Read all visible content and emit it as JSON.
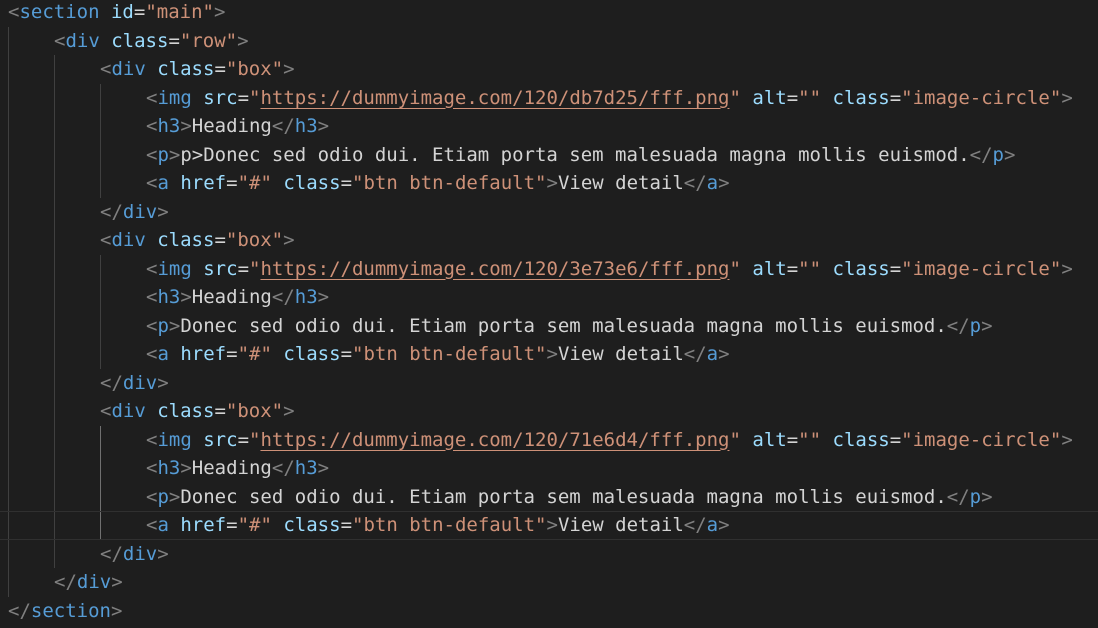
{
  "colors": {
    "background": "#1e1e1e",
    "punctuation": "#808080",
    "tag": "#569cd6",
    "attribute": "#9cdcfe",
    "string": "#ce9178",
    "text": "#d4d4d4"
  },
  "lines": [
    [
      [
        "pun",
        "<"
      ],
      [
        "tag",
        "section"
      ],
      [
        "plain",
        " "
      ],
      [
        "attr",
        "id"
      ],
      [
        "plain",
        "="
      ],
      [
        "str",
        "\"main\""
      ],
      [
        "pun",
        ">"
      ]
    ],
    [
      [
        "pun",
        "<"
      ],
      [
        "tag",
        "div"
      ],
      [
        "plain",
        " "
      ],
      [
        "attr",
        "class"
      ],
      [
        "plain",
        "="
      ],
      [
        "str",
        "\"row\""
      ],
      [
        "pun",
        ">"
      ]
    ],
    [
      [
        "pun",
        "<"
      ],
      [
        "tag",
        "div"
      ],
      [
        "plain",
        " "
      ],
      [
        "attr",
        "class"
      ],
      [
        "plain",
        "="
      ],
      [
        "str",
        "\"box\""
      ],
      [
        "pun",
        ">"
      ]
    ],
    [
      [
        "pun",
        "<"
      ],
      [
        "tag",
        "img"
      ],
      [
        "plain",
        " "
      ],
      [
        "attr",
        "src"
      ],
      [
        "plain",
        "="
      ],
      [
        "str",
        "\""
      ],
      [
        "link",
        "https://dummyimage.com/120/db7d25/fff.png"
      ],
      [
        "str",
        "\""
      ],
      [
        "plain",
        " "
      ],
      [
        "attr",
        "alt"
      ],
      [
        "plain",
        "="
      ],
      [
        "str",
        "\"\""
      ],
      [
        "plain",
        " "
      ],
      [
        "attr",
        "class"
      ],
      [
        "plain",
        "="
      ],
      [
        "str",
        "\"image-circle\""
      ],
      [
        "pun",
        ">"
      ]
    ],
    [
      [
        "pun",
        "<"
      ],
      [
        "tag",
        "h3"
      ],
      [
        "pun",
        ">"
      ],
      [
        "plain",
        "Heading"
      ],
      [
        "pun",
        "</"
      ],
      [
        "tag",
        "h3"
      ],
      [
        "pun",
        ">"
      ]
    ],
    [
      [
        "pun",
        "<"
      ],
      [
        "tag",
        "p"
      ],
      [
        "pun",
        ">"
      ],
      [
        "plain",
        "p>Donec sed odio dui. Etiam porta sem malesuada magna mollis euismod."
      ],
      [
        "pun",
        "</"
      ],
      [
        "tag",
        "p"
      ],
      [
        "pun",
        ">"
      ]
    ],
    [
      [
        "pun",
        "<"
      ],
      [
        "tag",
        "a"
      ],
      [
        "plain",
        " "
      ],
      [
        "attr",
        "href"
      ],
      [
        "plain",
        "="
      ],
      [
        "str",
        "\"#\""
      ],
      [
        "plain",
        " "
      ],
      [
        "attr",
        "class"
      ],
      [
        "plain",
        "="
      ],
      [
        "str",
        "\"btn btn-default\""
      ],
      [
        "pun",
        ">"
      ],
      [
        "plain",
        "View detail"
      ],
      [
        "pun",
        "</"
      ],
      [
        "tag",
        "a"
      ],
      [
        "pun",
        ">"
      ]
    ],
    [
      [
        "pun",
        "</"
      ],
      [
        "tag",
        "div"
      ],
      [
        "pun",
        ">"
      ]
    ],
    [
      [
        "pun",
        "<"
      ],
      [
        "tag",
        "div"
      ],
      [
        "plain",
        " "
      ],
      [
        "attr",
        "class"
      ],
      [
        "plain",
        "="
      ],
      [
        "str",
        "\"box\""
      ],
      [
        "pun",
        ">"
      ]
    ],
    [
      [
        "pun",
        "<"
      ],
      [
        "tag",
        "img"
      ],
      [
        "plain",
        " "
      ],
      [
        "attr",
        "src"
      ],
      [
        "plain",
        "="
      ],
      [
        "str",
        "\""
      ],
      [
        "link",
        "https://dummyimage.com/120/3e73e6/fff.png"
      ],
      [
        "str",
        "\""
      ],
      [
        "plain",
        " "
      ],
      [
        "attr",
        "alt"
      ],
      [
        "plain",
        "="
      ],
      [
        "str",
        "\"\""
      ],
      [
        "plain",
        " "
      ],
      [
        "attr",
        "class"
      ],
      [
        "plain",
        "="
      ],
      [
        "str",
        "\"image-circle\""
      ],
      [
        "pun",
        ">"
      ]
    ],
    [
      [
        "pun",
        "<"
      ],
      [
        "tag",
        "h3"
      ],
      [
        "pun",
        ">"
      ],
      [
        "plain",
        "Heading"
      ],
      [
        "pun",
        "</"
      ],
      [
        "tag",
        "h3"
      ],
      [
        "pun",
        ">"
      ]
    ],
    [
      [
        "pun",
        "<"
      ],
      [
        "tag",
        "p"
      ],
      [
        "pun",
        ">"
      ],
      [
        "plain",
        "Donec sed odio dui. Etiam porta sem malesuada magna mollis euismod."
      ],
      [
        "pun",
        "</"
      ],
      [
        "tag",
        "p"
      ],
      [
        "pun",
        ">"
      ]
    ],
    [
      [
        "pun",
        "<"
      ],
      [
        "tag",
        "a"
      ],
      [
        "plain",
        " "
      ],
      [
        "attr",
        "href"
      ],
      [
        "plain",
        "="
      ],
      [
        "str",
        "\"#\""
      ],
      [
        "plain",
        " "
      ],
      [
        "attr",
        "class"
      ],
      [
        "plain",
        "="
      ],
      [
        "str",
        "\"btn btn-default\""
      ],
      [
        "pun",
        ">"
      ],
      [
        "plain",
        "View detail"
      ],
      [
        "pun",
        "</"
      ],
      [
        "tag",
        "a"
      ],
      [
        "pun",
        ">"
      ]
    ],
    [
      [
        "pun",
        "</"
      ],
      [
        "tag",
        "div"
      ],
      [
        "pun",
        ">"
      ]
    ],
    [
      [
        "pun",
        "<"
      ],
      [
        "tag",
        "div"
      ],
      [
        "plain",
        " "
      ],
      [
        "attr",
        "class"
      ],
      [
        "plain",
        "="
      ],
      [
        "str",
        "\"box\""
      ],
      [
        "pun",
        ">"
      ]
    ],
    [
      [
        "pun",
        "<"
      ],
      [
        "tag",
        "img"
      ],
      [
        "plain",
        " "
      ],
      [
        "attr",
        "src"
      ],
      [
        "plain",
        "="
      ],
      [
        "str",
        "\""
      ],
      [
        "link",
        "https://dummyimage.com/120/71e6d4/fff.png"
      ],
      [
        "str",
        "\""
      ],
      [
        "plain",
        " "
      ],
      [
        "attr",
        "alt"
      ],
      [
        "plain",
        "="
      ],
      [
        "str",
        "\"\""
      ],
      [
        "plain",
        " "
      ],
      [
        "attr",
        "class"
      ],
      [
        "plain",
        "="
      ],
      [
        "str",
        "\"image-circle\""
      ],
      [
        "pun",
        ">"
      ]
    ],
    [
      [
        "pun",
        "<"
      ],
      [
        "tag",
        "h3"
      ],
      [
        "pun",
        ">"
      ],
      [
        "plain",
        "Heading"
      ],
      [
        "pun",
        "</"
      ],
      [
        "tag",
        "h3"
      ],
      [
        "pun",
        ">"
      ]
    ],
    [
      [
        "pun",
        "<"
      ],
      [
        "tag",
        "p"
      ],
      [
        "pun",
        ">"
      ],
      [
        "plain",
        "Donec sed odio dui. Etiam porta sem malesuada magna mollis euismod."
      ],
      [
        "pun",
        "</"
      ],
      [
        "tag",
        "p"
      ],
      [
        "pun",
        ">"
      ]
    ],
    [
      [
        "pun",
        "<"
      ],
      [
        "tag",
        "a"
      ],
      [
        "plain",
        " "
      ],
      [
        "attr",
        "href"
      ],
      [
        "plain",
        "="
      ],
      [
        "str",
        "\"#\""
      ],
      [
        "plain",
        " "
      ],
      [
        "attr",
        "class"
      ],
      [
        "plain",
        "="
      ],
      [
        "str",
        "\"btn btn-default\""
      ],
      [
        "pun",
        ">"
      ],
      [
        "plain",
        "View detail"
      ],
      [
        "pun",
        "</"
      ],
      [
        "tag",
        "a"
      ],
      [
        "pun",
        ">"
      ]
    ],
    [
      [
        "pun",
        "</"
      ],
      [
        "tag",
        "div"
      ],
      [
        "pun",
        ">"
      ]
    ],
    [
      [
        "pun",
        "</"
      ],
      [
        "tag",
        "div"
      ],
      [
        "pun",
        ">"
      ]
    ],
    [
      [
        "pun",
        "</"
      ],
      [
        "tag",
        "section"
      ],
      [
        "pun",
        ">"
      ]
    ]
  ]
}
